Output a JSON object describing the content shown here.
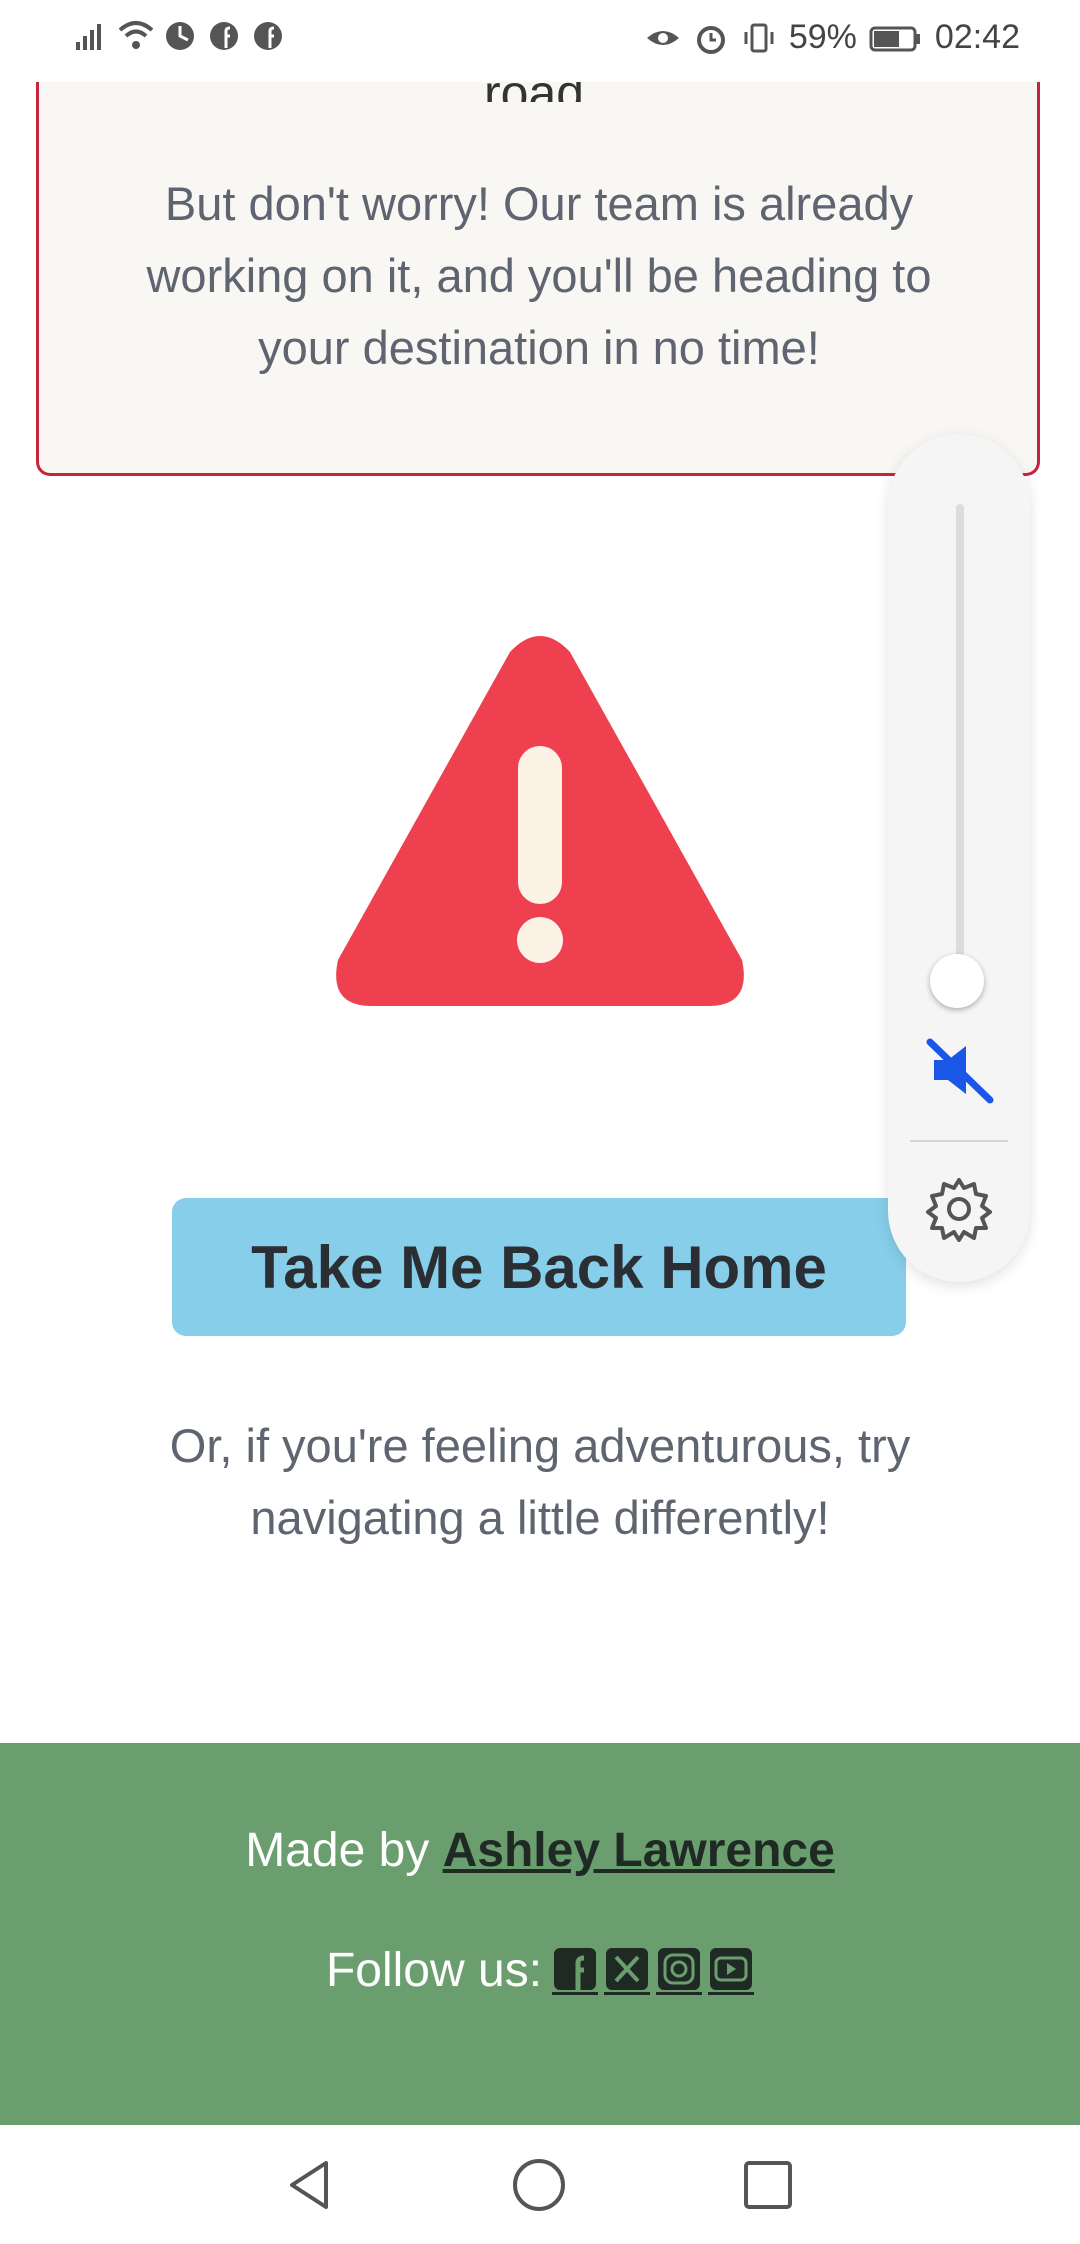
{
  "status_bar": {
    "battery_percent": "59%",
    "time": "02:42",
    "left_icons": [
      "signal-icon",
      "wifi-icon",
      "data-saver-icon",
      "facebook-icon",
      "facebook-icon"
    ],
    "right_icons": [
      "eye-icon",
      "alarm-icon",
      "vibrate-icon",
      "battery-icon"
    ]
  },
  "card": {
    "cut_text": "road.",
    "message": "But don't worry! Our team is already working on it, and you'll be heading to your destination in no time!"
  },
  "warning": {
    "icon": "warning-triangle-icon",
    "color": "#ef4050"
  },
  "home_button": {
    "label": "Take Me Back Home",
    "color": "#87ceeb"
  },
  "hint": "Or, if you're feeling adventurous, try navigating a little differently!",
  "footer": {
    "made_by_prefix": "Made by ",
    "author": "Ashley Lawrence",
    "follow_label": "Follow us: ",
    "social": [
      "facebook-icon",
      "x-icon",
      "instagram-icon",
      "youtube-icon"
    ],
    "background": "#6b9e6e"
  },
  "volume_panel": {
    "level": 0,
    "muted": true,
    "mute_icon": "speaker-muted-icon",
    "settings_icon": "gear-icon"
  },
  "nav_bar": {
    "buttons": [
      "back-icon",
      "home-icon",
      "recents-icon"
    ]
  }
}
